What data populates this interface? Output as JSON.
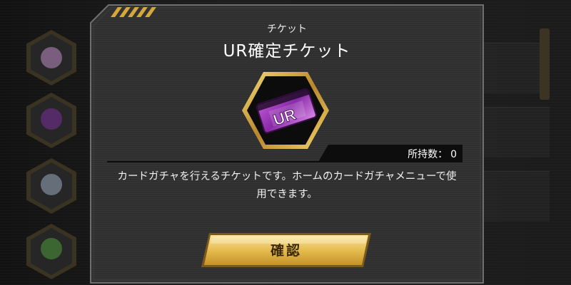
{
  "dialog": {
    "category": "チケット",
    "title": "UR確定チケット",
    "ticket_icon_text": "UR",
    "count_label": "所持数：",
    "count_value": "0",
    "description": "カードガチャを行えるチケットです。ホームのカードガチャメニューで使用できます。",
    "confirm_label": "確認"
  },
  "colors": {
    "accent_gold": "#d6a83a",
    "ticket_purple": "#9b3fb5",
    "panel": "#2f2f2f"
  }
}
